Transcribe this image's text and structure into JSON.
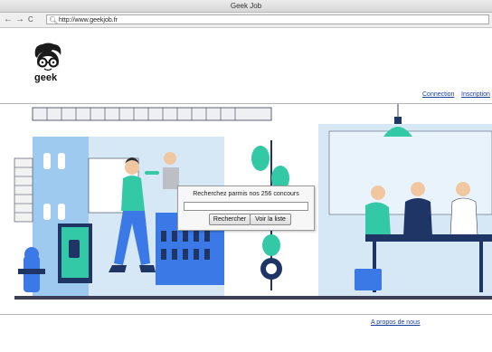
{
  "window": {
    "title": "Geek Job"
  },
  "toolbar": {
    "back": "←",
    "forward": "→",
    "reload": "C",
    "url": "http://www.geekjob.fr"
  },
  "brand": {
    "logo_text": "geek"
  },
  "header": {
    "connection": "Connection",
    "inscription": "Inscription"
  },
  "search": {
    "prompt": "Recherchez parmis nos 256 concours",
    "input_value": "",
    "search_button": "Rechercher",
    "list_button": "Voir la liste"
  },
  "footer": {
    "about": "A propos de nous"
  },
  "colors": {
    "teal": "#34c9a6",
    "blue": "#3a79e6",
    "navy": "#1e3566",
    "light_blue": "#d6e8f5"
  }
}
